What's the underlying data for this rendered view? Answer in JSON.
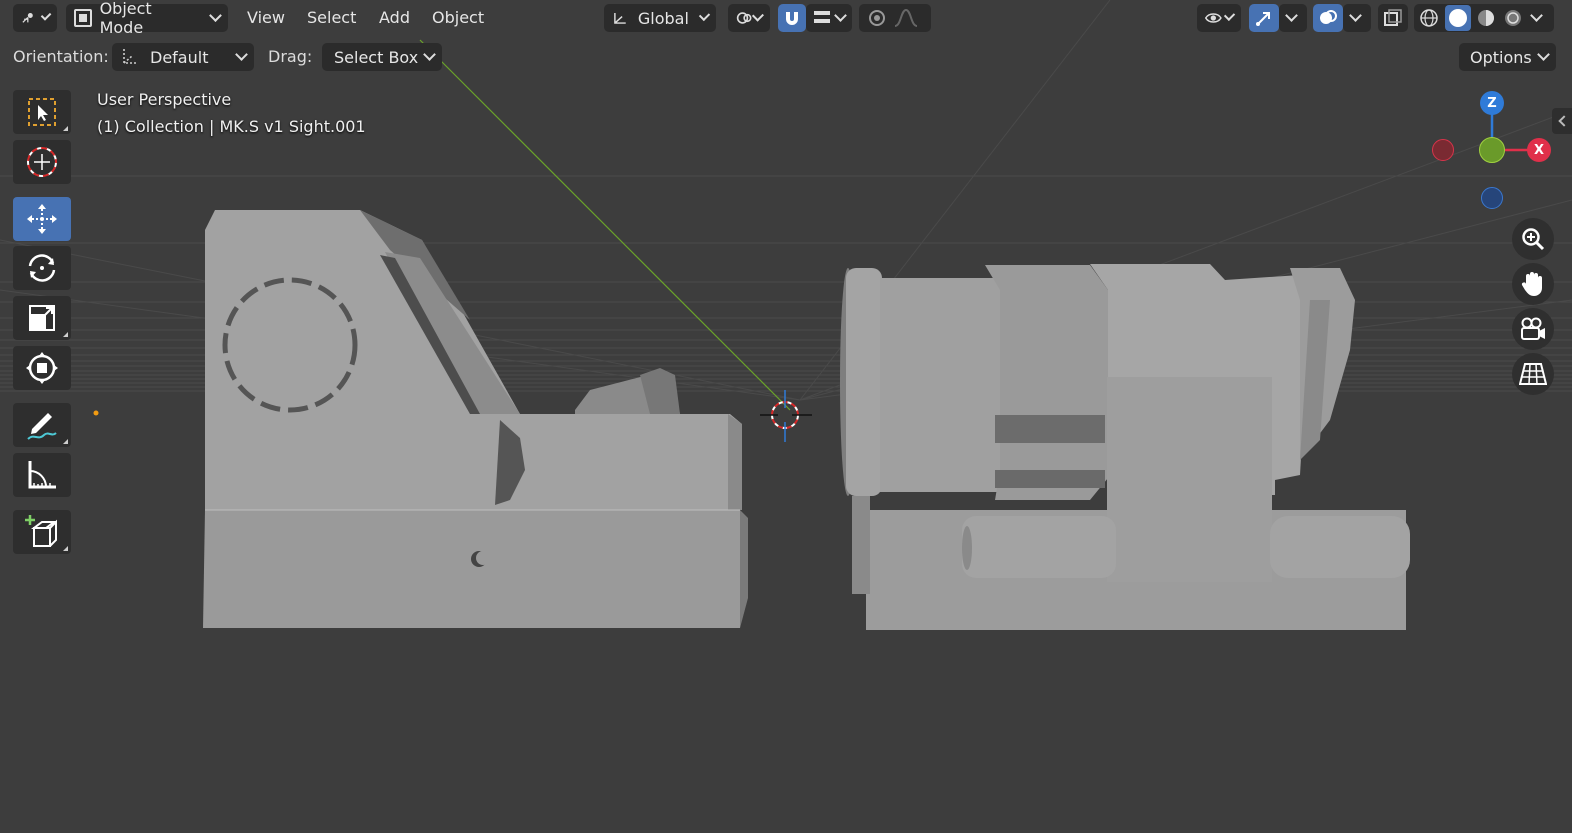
{
  "header": {
    "mode_label": "Object Mode",
    "menus": [
      "View",
      "Select",
      "Add",
      "Object"
    ],
    "transform_orientation": "Global"
  },
  "tool_header": {
    "orientation_label": "Orientation:",
    "orientation_value": "Default",
    "drag_label": "Drag:",
    "drag_value": "Select Box",
    "options_label": "Options"
  },
  "overlay": {
    "view_name": "User Perspective",
    "collection_info": "(1) Collection | MK.S v1 Sight.001"
  },
  "toolbar": {
    "tools": [
      "select-box",
      "cursor",
      "move",
      "rotate",
      "scale",
      "transform",
      "annotate",
      "measure",
      "add-cube"
    ],
    "active_tool": "move"
  },
  "gizmo": {
    "z_label": "Z",
    "x_label": "X"
  },
  "colors": {
    "accent": "#4772b3",
    "viewport_bg": "#3d3d3d",
    "axis_x": "#e0304a",
    "axis_y": "#7fb22e",
    "axis_z": "#2f7bd8"
  }
}
